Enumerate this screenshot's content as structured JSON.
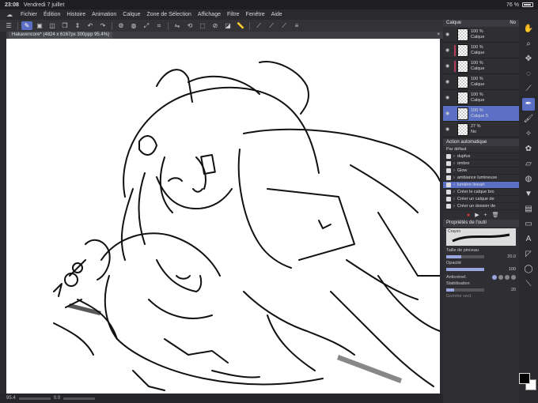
{
  "status": {
    "time": "23:08",
    "date": "Vendredi 7 juillet",
    "battery": "76 %",
    "battery_level": 0.76
  },
  "menu": [
    "Fichier",
    "Édition",
    "Histoire",
    "Animation",
    "Calque",
    "Zone de Sélection",
    "Affichage",
    "Filtre",
    "Fenêtre",
    "Aide"
  ],
  "tab": {
    "title": "Hakavencore* (4824 x 6167px 300ppp 95.4%)",
    "close": "×"
  },
  "bottom": {
    "zoom": "95.4",
    "angle": "0.0"
  },
  "layers": {
    "title": "Calque",
    "blend": "No",
    "items": [
      {
        "opacity": "100 %",
        "name": "Calque",
        "color": ""
      },
      {
        "opacity": "100 %",
        "name": "Calque",
        "color": "#b73a5a"
      },
      {
        "opacity": "100 %",
        "name": "Calque",
        "color": "#b73a5a"
      },
      {
        "opacity": "100 %",
        "name": "Calque",
        "color": ""
      },
      {
        "opacity": "100 %",
        "name": "Calque",
        "color": ""
      },
      {
        "opacity": "100 %",
        "name": "Calque 5",
        "color": "",
        "selected": true
      },
      {
        "opacity": "27 %",
        "name": "No",
        "color": ""
      }
    ]
  },
  "actions": {
    "title": "Action automatique",
    "preset": "Par défaut",
    "items": [
      "dupfus",
      "ombre",
      "Glow",
      "ambiance lumineuse",
      "lumière lineart",
      "Créer le calque bro",
      "Créer un calque de",
      "Créer un dossier de"
    ],
    "selected_index": 4
  },
  "tool": {
    "title": "Propriétés de l'outil",
    "brush": "Crayon",
    "size_label": "Taille de pinceau",
    "size": "20.0",
    "size_level": 0.4,
    "opacity_label": "Opacité",
    "opacity": "100",
    "opacity_level": 1.0,
    "antialias_label": "Anticrénel.",
    "stab_label": "Stabilisation",
    "stab": "20",
    "stab_level": 0.2,
    "vector_label": "Gomme vect."
  },
  "right_tools": [
    "hand-icon",
    "zoom-icon",
    "move-icon",
    "lasso-icon",
    "eyedropper-icon",
    "pen-icon",
    "brush-icon",
    "airbrush-icon",
    "decoration-icon",
    "eraser-icon",
    "blend-icon",
    "fill-icon",
    "gradient-icon",
    "figure-icon",
    "text-icon",
    "frame-icon",
    "balloon-icon",
    "line-icon"
  ],
  "colors": {
    "main": "#000000",
    "sub": "#ffffff",
    "accent": "#5b6fc4"
  }
}
